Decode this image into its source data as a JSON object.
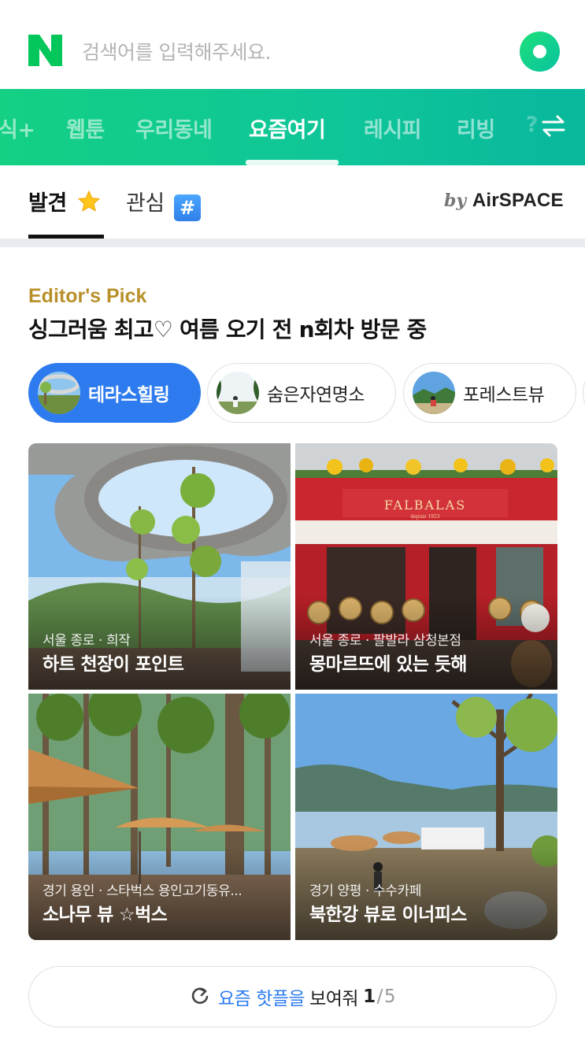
{
  "search": {
    "placeholder": "검색어를 입력해주세요."
  },
  "service_nav": {
    "items": [
      "식+",
      "웹툰",
      "우리동네",
      "요즘여기",
      "레시피",
      "리빙",
      "?"
    ],
    "active": "요즘여기"
  },
  "tabs": {
    "discover": "발견",
    "interest": "관심"
  },
  "sponsor": {
    "by": "by",
    "brand": "AirSPACE"
  },
  "editor_pick": {
    "label": "Editor's Pick",
    "headline": "싱그러움 최고♡ 여름 오기 전 n회차 방문 중"
  },
  "chips": [
    {
      "label": "테라스힐링",
      "active": true
    },
    {
      "label": "숨은자연명소",
      "active": false
    },
    {
      "label": "포레스트뷰",
      "active": false
    }
  ],
  "cards": [
    {
      "location": "서울 종로 · 희작",
      "title": "하트 천장이 포인트"
    },
    {
      "location": "서울 종로 · 팔발라 삼청본점",
      "title": "몽마르뜨에 있는 듯해"
    },
    {
      "location": "경기 용인 · 스타벅스 용인고기동유...",
      "title": "소나무 뷰 ☆벅스"
    },
    {
      "location": "경기 양평 · 수수카페",
      "title": "북한강 뷰로 이너피스"
    }
  ],
  "card_signs": {
    "falbalas": "FALBALAS",
    "since": "depuis 1923"
  },
  "more": {
    "highlight": "요즘 핫플을",
    "text": "보여줘",
    "current": "1",
    "sep": "/",
    "total": "5"
  },
  "colors": {
    "naver_green": "#03c75a",
    "accent_blue": "#2d7bef",
    "editor_gold": "#b8902b"
  }
}
